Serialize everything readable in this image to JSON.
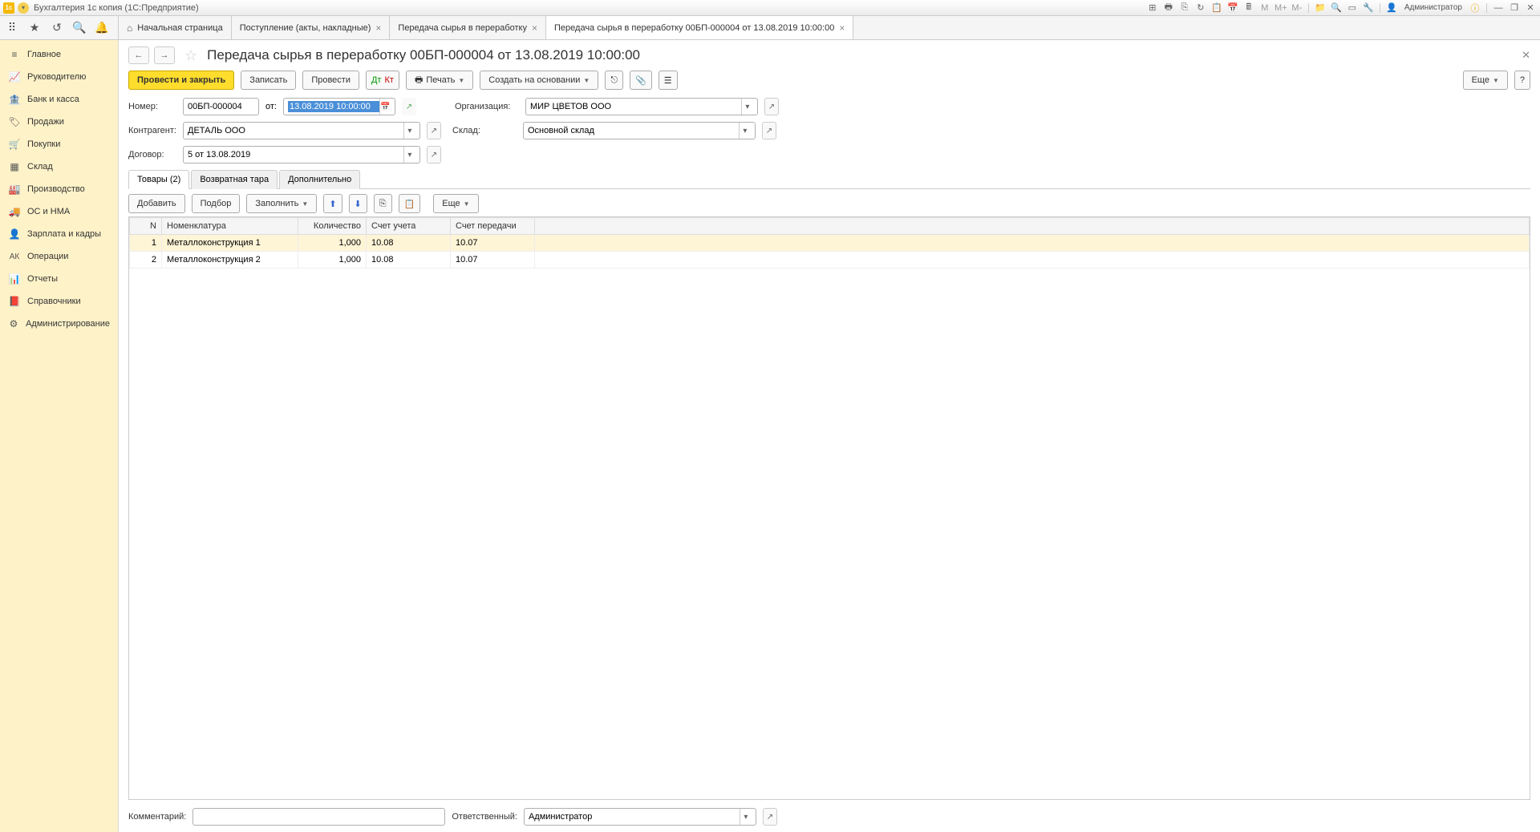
{
  "titlebar": {
    "app_title": "Бухгалтерия 1с копия (1С:Предприятие)",
    "user": "Администратор"
  },
  "tabs": [
    {
      "label": "Начальная страница",
      "home": true
    },
    {
      "label": "Поступление (акты, накладные)"
    },
    {
      "label": "Передача сырья в переработку"
    },
    {
      "label": "Передача сырья в переработку 00БП-000004 от 13.08.2019 10:00:00",
      "active": true
    }
  ],
  "sidebar": {
    "items": [
      {
        "label": "Главное",
        "icon": "menu"
      },
      {
        "label": "Руководителю",
        "icon": "chart"
      },
      {
        "label": "Банк и касса",
        "icon": "bank"
      },
      {
        "label": "Продажи",
        "icon": "tag"
      },
      {
        "label": "Покупки",
        "icon": "cart"
      },
      {
        "label": "Склад",
        "icon": "warehouse"
      },
      {
        "label": "Производство",
        "icon": "production"
      },
      {
        "label": "ОС и НМА",
        "icon": "truck"
      },
      {
        "label": "Зарплата и кадры",
        "icon": "person"
      },
      {
        "label": "Операции",
        "icon": "operations"
      },
      {
        "label": "Отчеты",
        "icon": "reports"
      },
      {
        "label": "Справочники",
        "icon": "book"
      },
      {
        "label": "Администрирование",
        "icon": "gear"
      }
    ]
  },
  "page": {
    "title": "Передача сырья в переработку 00БП-000004 от 13.08.2019 10:00:00"
  },
  "actions": {
    "post_close": "Провести и закрыть",
    "save": "Записать",
    "post": "Провести",
    "print": "Печать",
    "create_based": "Создать на основании",
    "more": "Еще"
  },
  "form": {
    "number_label": "Номер:",
    "number": "00БП-000004",
    "from_label": "от:",
    "date": "13.08.2019 10:00:00",
    "org_label": "Организация:",
    "org": "МИР ЦВЕТОВ ООО",
    "contractor_label": "Контрагент:",
    "contractor": "ДЕТАЛЬ ООО",
    "warehouse_label": "Склад:",
    "warehouse": "Основной склад",
    "contract_label": "Договор:",
    "contract": "5 от 13.08.2019"
  },
  "doc_tabs": {
    "goods": "Товары (2)",
    "returnable": "Возвратная тара",
    "additional": "Дополнительно"
  },
  "table_actions": {
    "add": "Добавить",
    "select": "Подбор",
    "fill": "Заполнить",
    "more": "Еще"
  },
  "table": {
    "headers": {
      "n": "N",
      "nomenclature": "Номенклатура",
      "quantity": "Количество",
      "account": "Счет учета",
      "transfer_account": "Счет передачи"
    },
    "rows": [
      {
        "n": "1",
        "name": "Металлоконструкция 1",
        "qty": "1,000",
        "acc": "10.08",
        "tacc": "10.07"
      },
      {
        "n": "2",
        "name": "Металлоконструкция 2",
        "qty": "1,000",
        "acc": "10.08",
        "tacc": "10.07"
      }
    ]
  },
  "bottom": {
    "comment_label": "Комментарий:",
    "responsible_label": "Ответственный:",
    "responsible": "Администратор"
  }
}
